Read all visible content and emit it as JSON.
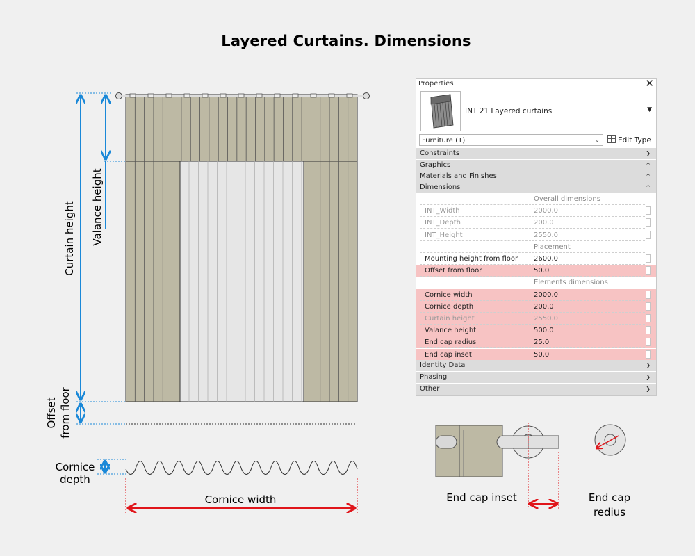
{
  "title": "Layered Curtains. Dimensions",
  "labels": {
    "curtain_height": "Curtain height",
    "valance_height": "Valance height",
    "offset_from_floor_line1": "Offset",
    "offset_from_floor_line2": "from floor",
    "cornice_depth_line1": "Cornice",
    "cornice_depth_line2": "depth",
    "cornice_width": "Cornice width",
    "end_cap_inset": "End cap inset",
    "end_cap_radius_line1": "End cap",
    "end_cap_radius_line2": "redius"
  },
  "colors": {
    "curtain_fill": "#bdb9a4",
    "sheer_fill": "#e6e6e6",
    "blue_dim": "#1a88d8",
    "red_dim": "#e0151a",
    "highlight_row": "#f7c3c3"
  },
  "properties": {
    "panel_title": "Properties",
    "close_icon": "✕",
    "type_name": "INT 21 Layered curtains",
    "filter": "Furniture (1)",
    "edit_type": "Edit Type",
    "groups": {
      "constraints": "Constraints",
      "graphics": "Graphics",
      "materials": "Materials and Finishes",
      "dimensions": "Dimensions",
      "identity": "Identity Data",
      "phasing": "Phasing",
      "other": "Other"
    },
    "rows": [
      {
        "name": "",
        "value": "Overall dimensions",
        "type": "section"
      },
      {
        "name": "INT_Width",
        "value": "2000.0",
        "type": "readonly"
      },
      {
        "name": "INT_Depth",
        "value": "200.0",
        "type": "readonly"
      },
      {
        "name": "INT_Height",
        "value": "2550.0",
        "type": "readonly"
      },
      {
        "name": "",
        "value": "Placement",
        "type": "section"
      },
      {
        "name": "Mounting height from floor",
        "value": "2600.0",
        "type": "normal"
      },
      {
        "name": "Offset from floor",
        "value": "50.0",
        "type": "highlight"
      },
      {
        "name": "",
        "value": "Elements dimensions",
        "type": "section"
      },
      {
        "name": "Cornice width",
        "value": "2000.0",
        "type": "highlight"
      },
      {
        "name": "Cornice depth",
        "value": "200.0",
        "type": "highlight"
      },
      {
        "name": "Curtain height",
        "value": "2550.0",
        "type": "highlight-grey"
      },
      {
        "name": "Valance height",
        "value": "500.0",
        "type": "highlight"
      },
      {
        "name": "End cap radius",
        "value": "25.0",
        "type": "highlight"
      },
      {
        "name": "End cap inset",
        "value": "50.0",
        "type": "highlight"
      }
    ]
  }
}
